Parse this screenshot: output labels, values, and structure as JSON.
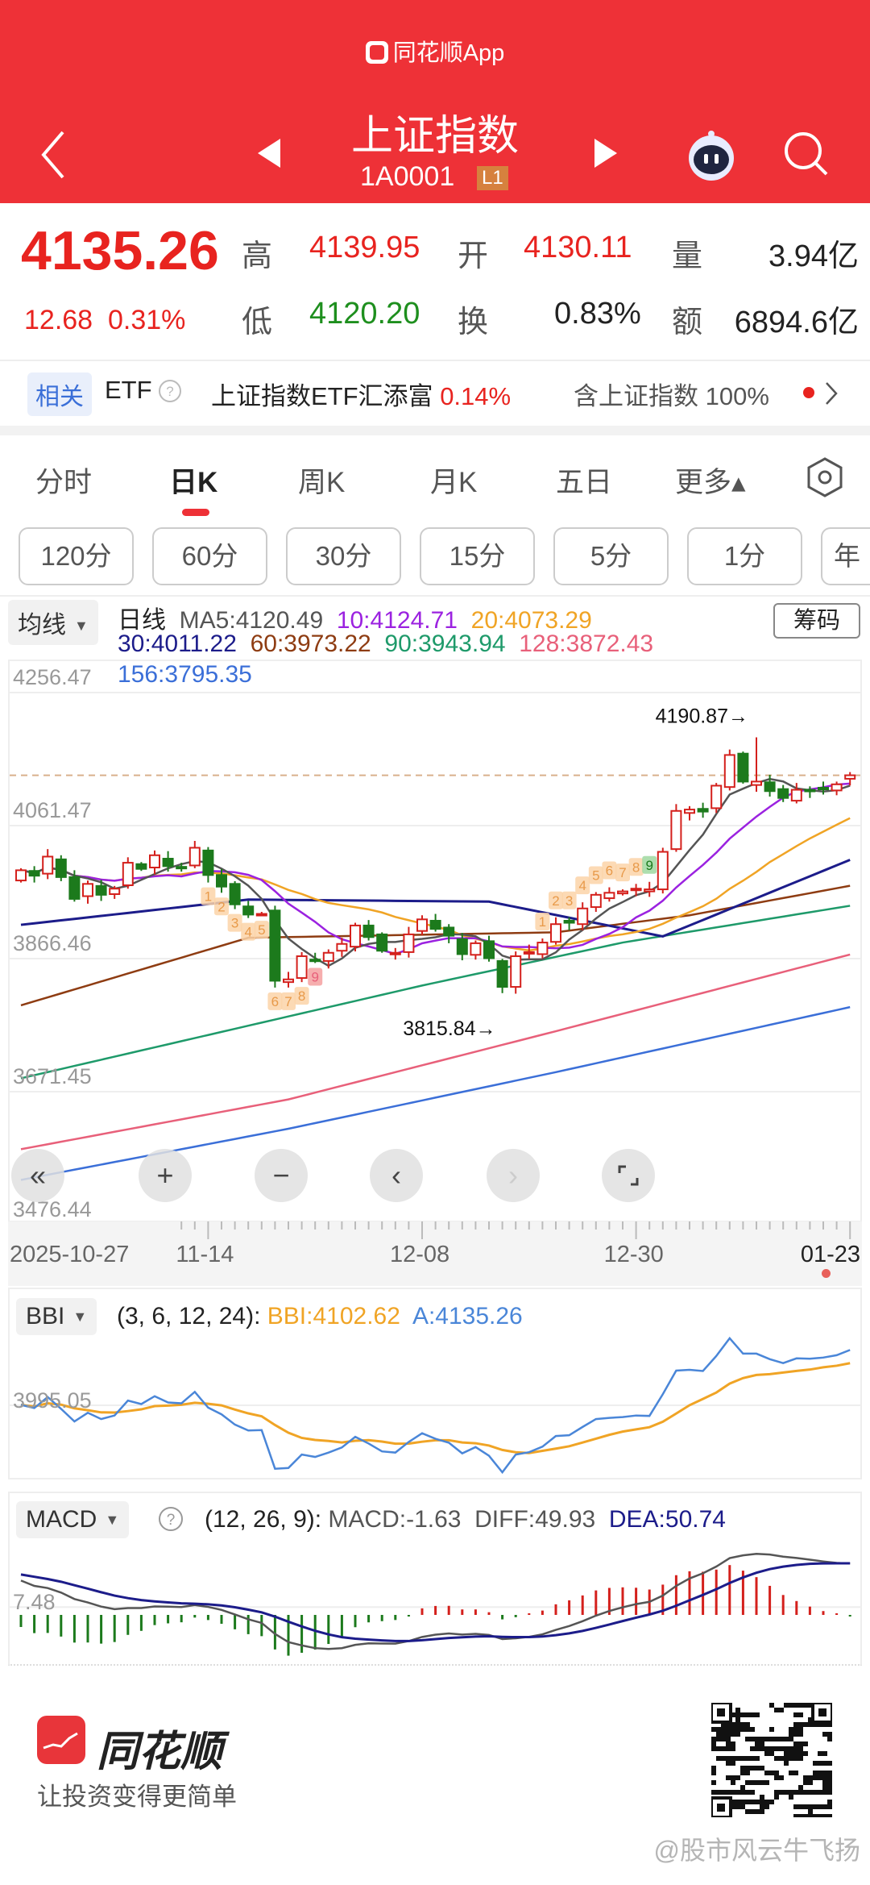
{
  "app_banner": "同花顺App",
  "header": {
    "title": "上证指数",
    "code": "1A0001",
    "level_badge": "L1",
    "icons": [
      "back-chevron-icon",
      "prev-stock-icon",
      "next-stock-icon",
      "robot-assistant-icon",
      "search-icon"
    ]
  },
  "quote": {
    "price": "4135.26",
    "change": "12.68",
    "change_pct": "0.31%",
    "high_label": "高",
    "high": "4139.95",
    "open_label": "开",
    "open": "4130.11",
    "volume_label": "量",
    "volume": "3.94亿",
    "low_label": "低",
    "low": "4120.20",
    "turnover_label": "换",
    "turnover": "0.83%",
    "amount_label": "额",
    "amount": "6894.6亿"
  },
  "related": {
    "tag": "相关",
    "etf": "ETF",
    "etf_name": "上证指数ETF汇添富",
    "etf_change": "0.14%",
    "contains": "含上证指数",
    "weight": "100%"
  },
  "tabs": [
    {
      "label": "分时"
    },
    {
      "label": "日K",
      "active": true
    },
    {
      "label": "周K"
    },
    {
      "label": "月K"
    },
    {
      "label": "五日"
    },
    {
      "label": "更多▴"
    }
  ],
  "intervals": [
    "120分",
    "60分",
    "30分",
    "15分",
    "5分",
    "1分",
    "年"
  ],
  "ma_legend": {
    "selector": "均线",
    "period": "日线",
    "chips": "筹码",
    "items": [
      {
        "label": "MA5:4120.49",
        "color": "#555555"
      },
      {
        "label": "10:4124.71",
        "color": "#9b22e0"
      },
      {
        "label": "20:4073.29",
        "color": "#f0a425"
      },
      {
        "label": "30:4011.22",
        "color": "#1c1c8a"
      },
      {
        "label": "60:3973.22",
        "color": "#8e3c12"
      },
      {
        "label": "90:3943.94",
        "color": "#1e9a6a"
      },
      {
        "label": "128:3872.43",
        "color": "#e8607a"
      },
      {
        "label": "156:3795.35",
        "color": "#3b6fd8"
      }
    ]
  },
  "colors": {
    "up": "#d4201c",
    "down": "#1c7a1c",
    "brand": "#ee3137"
  },
  "chart_data": {
    "type": "candlestick",
    "title": "上证指数 日K",
    "y_ticks": [
      "4256.47",
      "4061.47",
      "3866.46",
      "3671.45",
      "3476.44"
    ],
    "ylim": [
      3476.44,
      4256.47
    ],
    "x_ticks": [
      {
        "label": "2025-10-27",
        "index": 0
      },
      {
        "label": "11-14",
        "index": 14
      },
      {
        "label": "12-08",
        "index": 30
      },
      {
        "label": "12-30",
        "index": 46
      },
      {
        "label": "01-23",
        "index": 62
      }
    ],
    "closes": [
      3996,
      3988,
      4016,
      3986,
      3954,
      3976,
      3960,
      3969,
      4007,
      3998,
      4018,
      4002,
      4000,
      4029,
      3989,
      3972,
      3946,
      3931,
      3932,
      3834,
      3836,
      3870,
      3864,
      3875,
      3888,
      3915,
      3898,
      3878,
      3875,
      3902,
      3924,
      3910,
      3900,
      3873,
      3889,
      3867,
      3825,
      3870,
      3876,
      3890,
      3917,
      3919,
      3940,
      3960,
      3963,
      3965,
      3969,
      3968,
      4023,
      4083,
      4085,
      4082,
      4120,
      4165,
      4126,
      4126,
      4112,
      4102,
      4114,
      4113,
      4116,
      4122,
      4135.26
    ],
    "last_ohlc": {
      "open": 4130.11,
      "high": 4139.95,
      "low": 4120.2,
      "close": 4135.26
    },
    "max_mark": {
      "label": "4190.87→",
      "index": 55,
      "value": 4190.87
    },
    "min_mark": {
      "label": "3815.84→",
      "index": 36,
      "value": 3815.84
    },
    "long_ma": {
      "ma30": [
        [
          0,
          3916
        ],
        [
          17,
          3953
        ],
        [
          35,
          3950
        ],
        [
          48,
          3899
        ],
        [
          62,
          4011.22
        ]
      ],
      "ma60": [
        [
          0,
          3798
        ],
        [
          17,
          3897
        ],
        [
          40,
          3905
        ],
        [
          50,
          3930
        ],
        [
          62,
          3973.22
        ]
      ],
      "ma90": [
        [
          0,
          3691
        ],
        [
          30,
          3827
        ],
        [
          45,
          3890
        ],
        [
          62,
          3943.94
        ]
      ],
      "ma128": [
        [
          0,
          3587
        ],
        [
          20,
          3660
        ],
        [
          40,
          3760
        ],
        [
          62,
          3872.43
        ]
      ],
      "ma156": [
        [
          0,
          3542
        ],
        [
          20,
          3617
        ],
        [
          40,
          3700
        ],
        [
          62,
          3795.35
        ]
      ]
    },
    "td_markers": [
      {
        "index": 14,
        "n": "1"
      },
      {
        "index": 15,
        "n": "2"
      },
      {
        "index": 16,
        "n": "3"
      },
      {
        "index": 17,
        "n": "4"
      },
      {
        "index": 18,
        "n": "5"
      },
      {
        "index": 19,
        "n": "6"
      },
      {
        "index": 20,
        "n": "7"
      },
      {
        "index": 21,
        "n": "8"
      },
      {
        "index": 22,
        "n": "9"
      },
      {
        "index": 39,
        "n": "1"
      },
      {
        "index": 40,
        "n": "2"
      },
      {
        "index": 41,
        "n": "3"
      },
      {
        "index": 42,
        "n": "4"
      },
      {
        "index": 43,
        "n": "5"
      },
      {
        "index": 44,
        "n": "6"
      },
      {
        "index": 45,
        "n": "7"
      },
      {
        "index": 46,
        "n": "8"
      },
      {
        "index": 47,
        "n": "9"
      }
    ]
  },
  "controls": [
    "collapse-left",
    "zoom-in",
    "zoom-out",
    "scroll-left",
    "scroll-right",
    "fullscreen"
  ],
  "bbi": {
    "selector": "BBI",
    "params": "(3, 6, 12, 24):",
    "bbi": "BBI:4102.62",
    "a": "A:4135.26",
    "y_tick": "3995.05"
  },
  "macd": {
    "selector": "MACD",
    "params": "(12, 26, 9):",
    "macd": "MACD:-1.63",
    "diff": "DIFF:49.93",
    "dea": "DEA:50.74",
    "y_tick": "7.48"
  },
  "footer": {
    "brand": "同花顺",
    "slogan": "让投资变得更简单",
    "watermark": "@股市风云牛飞扬"
  }
}
